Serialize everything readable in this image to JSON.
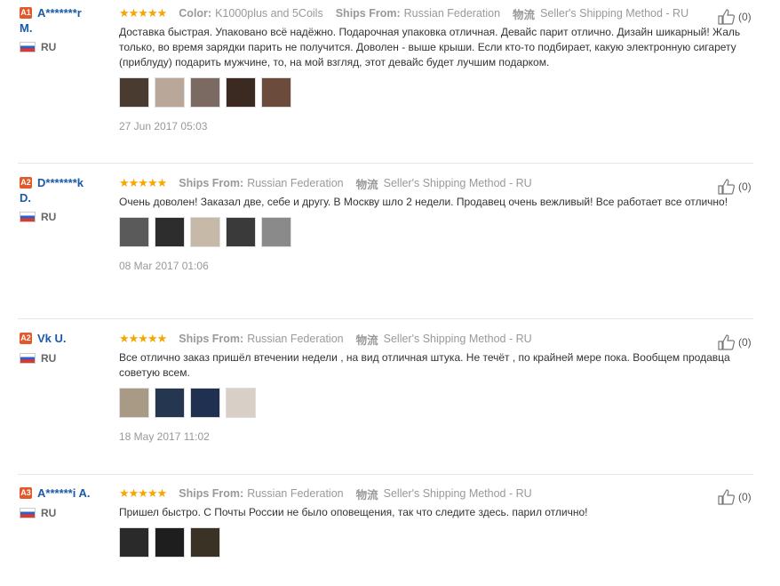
{
  "reviews": [
    {
      "badge": "A1",
      "name_line1": "A*******r",
      "name_line2": "M.",
      "country": "RU",
      "stars": "★★★★★",
      "color_label": "Color:",
      "color_value": "K1000plus and 5Coils",
      "ships_label": "Ships From:",
      "ships_value": "Russian Federation",
      "method_icon": "物流",
      "method_value": "Seller's Shipping Method - RU",
      "text": "Доставка быстрая. Упаковано всё надёжно. Подарочная упаковка отличная. Девайс парит отлично. Дизайн шикарный! Жаль только, во время зарядки парить не получится. Доволен - выше крыши. Если кто-то подбирает, какую электронную сигарету (приблуду) подарить мужчине, то, на мой взгляд, этот девайс будет лучшим подарком.",
      "date": "27 Jun 2017 05:03",
      "helpful": "(0)",
      "thumb_colors": [
        "#4a3b30",
        "#b9a79a",
        "#7a6a61",
        "#3a2a22",
        "#6b4b3b"
      ]
    },
    {
      "badge": "A2",
      "name_line1": "D*******k",
      "name_line2": "D.",
      "country": "RU",
      "stars": "★★★★★",
      "ships_label": "Ships From:",
      "ships_value": "Russian Federation",
      "method_icon": "物流",
      "method_value": "Seller's Shipping Method - RU",
      "text": "Очень доволен! Заказал две, себе и другу. В Москву шло 2 недели. Продавец очень вежливый! Все работает все отлично!",
      "date": "08 Mar 2017 01:06",
      "helpful": "(0)",
      "thumb_colors": [
        "#5a5a5a",
        "#2d2d2d",
        "#c7b9a8",
        "#3a3a3a",
        "#8a8a8a"
      ]
    },
    {
      "badge": "A2",
      "name_line1": "Vk U.",
      "name_line2": "",
      "country": "RU",
      "stars": "★★★★★",
      "ships_label": "Ships From:",
      "ships_value": "Russian Federation",
      "method_icon": "物流",
      "method_value": "Seller's Shipping Method - RU",
      "text": "Все отлично заказ пришёл втечении недели , на вид отличная штука. Не течёт , по крайней мере пока. Вообщем продавца советую всем.",
      "date": "18 May 2017 11:02",
      "helpful": "(0)",
      "thumb_colors": [
        "#a99a85",
        "#243650",
        "#1f3050",
        "#d8d0c6"
      ]
    },
    {
      "badge": "A3",
      "name_line1": "A******i A.",
      "name_line2": "",
      "country": "RU",
      "stars": "★★★★★",
      "ships_label": "Ships From:",
      "ships_value": "Russian Federation",
      "method_icon": "物流",
      "method_value": "Seller's Shipping Method - RU",
      "text": "Пришел быстро. С Почты России не было оповещения, так что следите здесь. парил отлично!",
      "date": "",
      "helpful": "(0)",
      "thumb_colors": [
        "#2a2a2a",
        "#1e1e1e",
        "#3b3226"
      ]
    }
  ]
}
